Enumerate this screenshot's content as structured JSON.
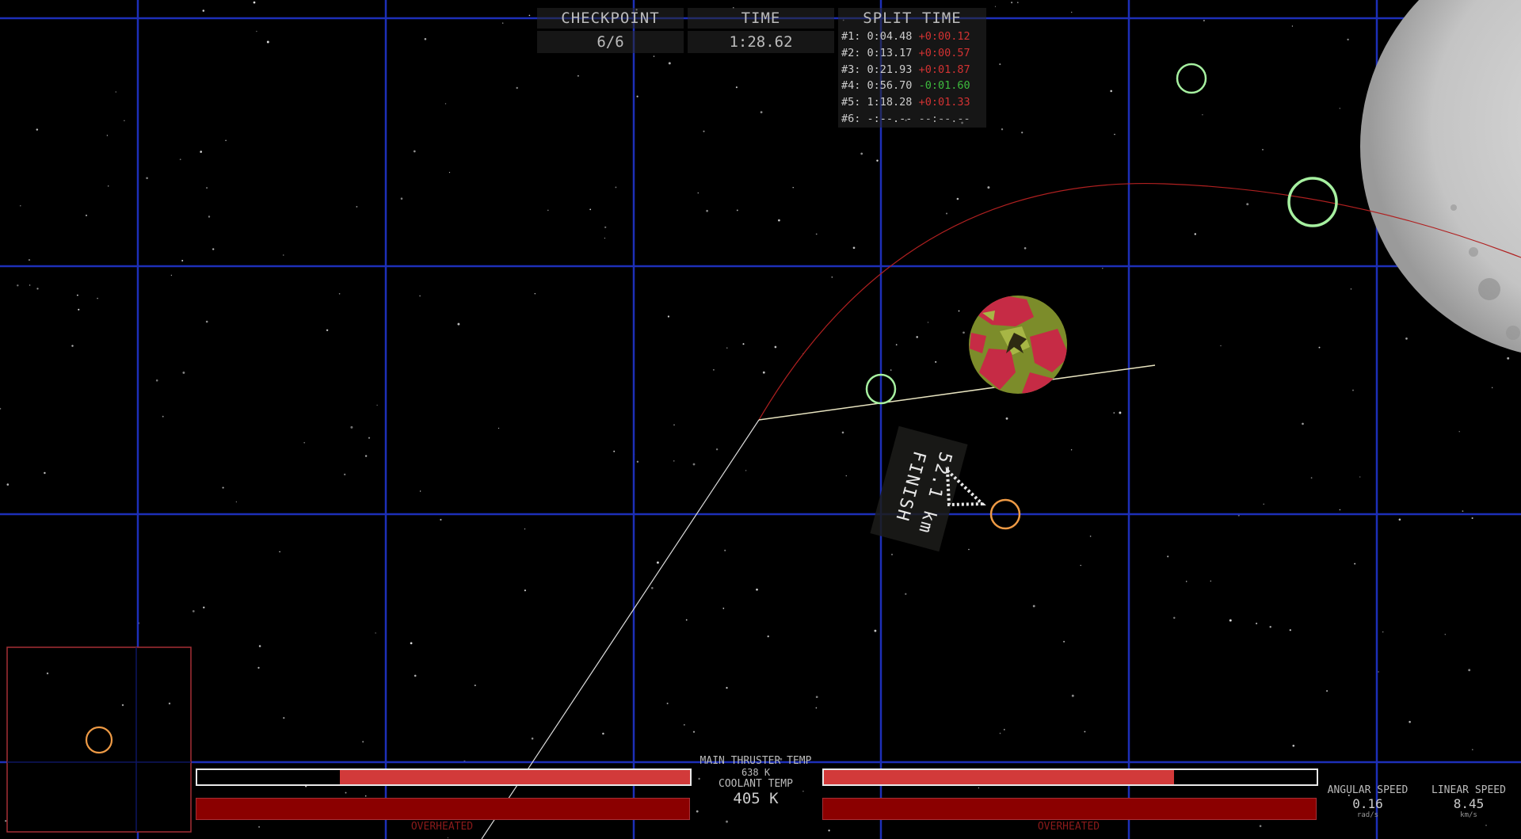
{
  "hud": {
    "checkpoint": {
      "label": "CHECKPOINT",
      "value": "6/6"
    },
    "time": {
      "label": "TIME",
      "value": "1:28.62"
    },
    "split": {
      "label": "SPLIT TIME",
      "rows": [
        {
          "id": "#1:",
          "time": "0:04.48",
          "delta": "+0:00.12",
          "kind": "pos"
        },
        {
          "id": "#2:",
          "time": "0:13.17",
          "delta": "+0:00.57",
          "kind": "pos"
        },
        {
          "id": "#3:",
          "time": "0:21.93",
          "delta": "+0:01.87",
          "kind": "pos"
        },
        {
          "id": "#4:",
          "time": "0:56.70",
          "delta": "-0:01.60",
          "kind": "neg"
        },
        {
          "id": "#5:",
          "time": "1:18.28",
          "delta": "+0:01.33",
          "kind": "pos"
        },
        {
          "id": "#6:",
          "time": "-:--.--",
          "delta": "--:--.--",
          "kind": "none"
        }
      ]
    },
    "marker": {
      "distance": "52.1 km",
      "label": "FINISH"
    },
    "thruster": {
      "label": "MAIN THRUSTER TEMP",
      "value": "638 K",
      "level": 0.71
    },
    "coolant": {
      "label": "COOLANT TEMP",
      "value": "405 K"
    },
    "overheated_left": "OVERHEATED",
    "overheated_right": "OVERHEATED",
    "angular": {
      "label": "ANGULAR SPEED",
      "value": "0.16",
      "unit": "rad/s"
    },
    "linear": {
      "label": "LINEAR SPEED",
      "value": "8.45",
      "unit": "km/s"
    }
  },
  "colors": {
    "grid": "#1d2fb8",
    "checkpoint_next": "#a6f0a0",
    "checkpoint_target": "#ee9a45",
    "trajectory": "#b02020",
    "bar_red": "#d23a3a",
    "bar_dark": "#8b0000",
    "minimap_border": "#a52f35"
  }
}
